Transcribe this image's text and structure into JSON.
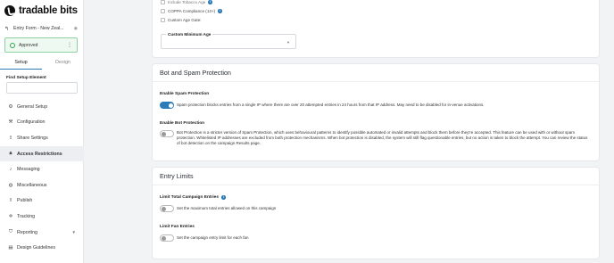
{
  "brand": {
    "name": "tradable bits"
  },
  "sidebar": {
    "campaign_title": "Entry Form - New Zeal...",
    "status_label": "Approved",
    "tabs": [
      {
        "label": "Setup"
      },
      {
        "label": "Design"
      }
    ],
    "find_label": "Find Setup Element",
    "nav": [
      {
        "label": "General Setup",
        "icon": "gear-icon"
      },
      {
        "label": "Configuration",
        "icon": "wrench-icon"
      },
      {
        "label": "Share Settings",
        "icon": "share-icon"
      },
      {
        "label": "Access Restrictions",
        "icon": "lock-icon"
      },
      {
        "label": "Messaging",
        "icon": "bell-icon"
      },
      {
        "label": "Miscellaneous",
        "icon": "globe-icon"
      },
      {
        "label": "Publish",
        "icon": "upload-icon"
      },
      {
        "label": "Tracking",
        "icon": "crosshair-icon"
      },
      {
        "label": "Reporting",
        "icon": "shield-icon"
      },
      {
        "label": "Design Guidelines",
        "icon": "book-icon"
      }
    ]
  },
  "age": {
    "partial_label": "Include Tobacco Age",
    "coppa_label": "COPPA Compliance (13+)",
    "custom_gate_label": "Custom Age Gate:",
    "custom_min_label": "Custom Minimum Age"
  },
  "spam": {
    "heading": "Bot and Spam Protection",
    "enable_spam_label": "Enable Spam Protection",
    "enable_spam_desc": "Spam protection blocks entries from a single IP where there are over 20 attempted entries in 24 hours from that IP address. May need to be disabled for in-venue activations.",
    "enable_bot_label": "Enable Bot Protection",
    "enable_bot_desc": "Bot Protection is a stricter version of Spam Protection, which uses behavioural patterns to identify possible automated or invalid attempts and block them before they're accepted. This feature can be used with or without spam protection. Whitelisted IP addresses are excluded from both protection mechanisms. When bot protection is disabled, the system will still flag questionable entries, but no action is taken to block the attempt. You can review the status of bot detection on the campaign Results page."
  },
  "limits": {
    "heading": "Entry Limits",
    "total_label": "Limit Total Campaign Entries",
    "total_desc": "Set the maximum total entries allowed on this campaign",
    "fan_label": "Limit Fan Entries",
    "fan_desc": "Set the campaign entry limit for each fan"
  },
  "colors": {
    "accent": "#2b7bb9",
    "approved_border": "#8fd19e",
    "approved_bg": "#eef9f1"
  }
}
